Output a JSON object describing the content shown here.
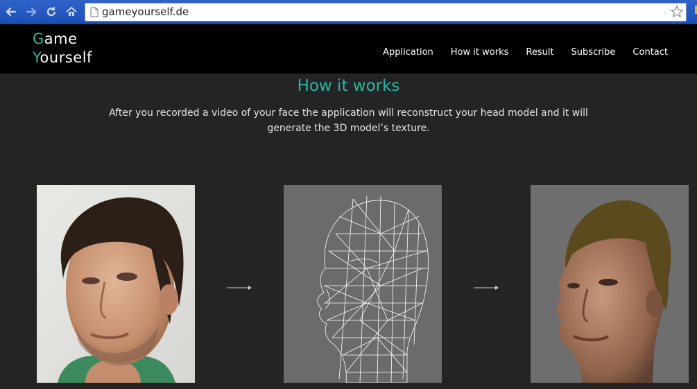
{
  "browser": {
    "url": "gameyourself.de",
    "icons": [
      "back-icon",
      "forward-icon",
      "reload-icon",
      "home-icon",
      "page-icon",
      "star-icon"
    ]
  },
  "site": {
    "logo_line1_initial": "G",
    "logo_line1_rest": "ame",
    "logo_line2_initial": "Y",
    "logo_line2_rest": "ourself",
    "nav": [
      "Application",
      "How it works",
      "Result",
      "Subscribe",
      "Contact"
    ]
  },
  "section": {
    "title": "How it works",
    "description": "After you recorded a video of your face the application will reconstruct your head model and it will generate the 3D model’s texture."
  },
  "steps": {
    "items": [
      "photo-of-face",
      "wireframe-head-model",
      "textured-head-model"
    ]
  },
  "colors": {
    "accent": "#2ab5a6",
    "header_bg": "#000000",
    "content_bg": "#242424",
    "chrome_blue": "#2458c2"
  }
}
